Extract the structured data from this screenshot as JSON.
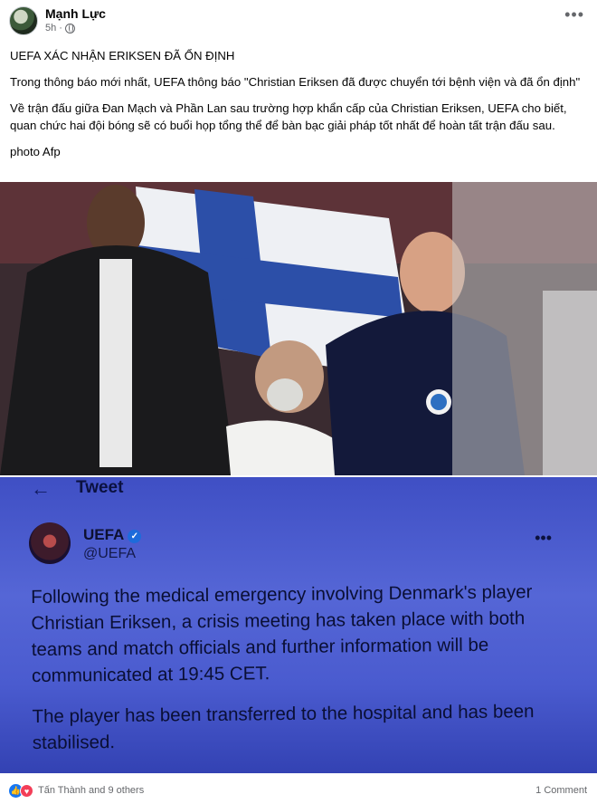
{
  "post": {
    "author": "Mạnh Lực",
    "time": "5h",
    "privacy_icon": "globe-icon",
    "paragraphs": [
      "UEFA XÁC NHẬN ERIKSEN ĐÃ ỔN ĐỊNH",
      "Trong thông báo mới nhất, UEFA thông báo \"Christian Eriksen đã được chuyển tới bệnh viện và đã ổn định\"",
      "Về trận đấu giữa Đan Mạch và Phần Lan sau trường hợp khẩn cấp của Christian Eriksen, UEFA cho biết, quan chức hai đội bóng sẽ có buổi họp tổng thể để bàn bạc giải pháp tốt nhất để hoàn tất trận đấu sau.",
      "photo Afp"
    ]
  },
  "tweet_screenshot": {
    "header": "Tweet",
    "account_name": "UEFA",
    "handle": "@UEFA",
    "paragraphs": [
      "Following the medical emergency involving Denmark's player Christian Eriksen, a crisis meeting has taken place with both teams and match officials and further information will be communicated at 19:45 CET.",
      "The player has been transferred to the hospital and has been stabilised."
    ]
  },
  "footer": {
    "reactions_text": "Tấn Thành and 9 others",
    "comments": "1 Comment"
  },
  "colors": {
    "like": "#1877f2",
    "love": "#f33e58",
    "secondary_text": "#65676b"
  }
}
